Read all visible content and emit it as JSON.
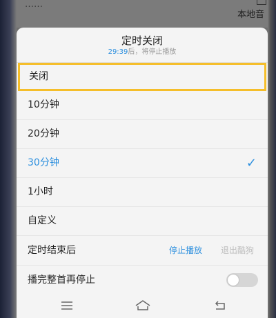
{
  "background": {
    "top_text": "……",
    "right_label": "本地音"
  },
  "sheet": {
    "title": "定时关闭",
    "countdown": "29:39",
    "subtitle_rest": "后，将停止播放",
    "options": [
      {
        "label": "关闭",
        "highlighted": true,
        "selected": false
      },
      {
        "label": "10分钟",
        "highlighted": false,
        "selected": false
      },
      {
        "label": "20分钟",
        "highlighted": false,
        "selected": false
      },
      {
        "label": "30分钟",
        "highlighted": false,
        "selected": true
      },
      {
        "label": "1小时",
        "highlighted": false,
        "selected": false
      },
      {
        "label": "自定义",
        "highlighted": false,
        "selected": false
      }
    ],
    "after_timer": {
      "label": "定时结束后",
      "choice_active": "停止播放",
      "choice_inactive": "退出酷狗"
    },
    "finish_song": {
      "label": "播完整首再停止",
      "enabled": false
    }
  },
  "nav": {
    "icons": [
      "menu-icon",
      "home-icon",
      "back-icon"
    ]
  },
  "colors": {
    "accent": "#2c8fde",
    "highlight_border": "#f5be2a",
    "sheet_bg": "#f4f4f4"
  }
}
